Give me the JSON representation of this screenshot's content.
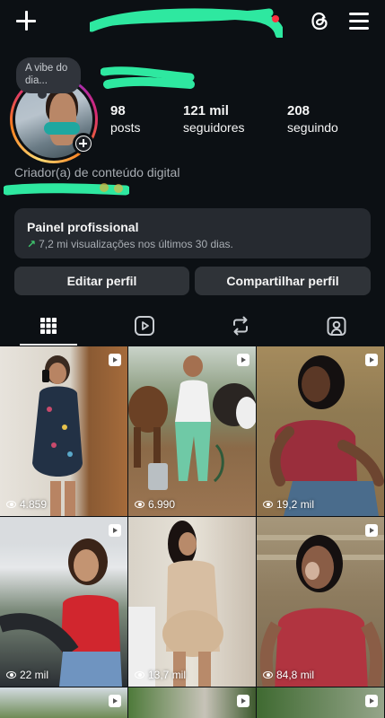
{
  "profile": {
    "note": "A vibe do dia...",
    "stats": [
      {
        "value": "98",
        "label": "posts"
      },
      {
        "value": "121 mil",
        "label": "seguidores"
      },
      {
        "value": "208",
        "label": "seguindo"
      }
    ],
    "category": "Criador(a) de conteúdo digital"
  },
  "panel": {
    "title": "Painel profissional",
    "subtitle": "7,2 mi visualizações nos últimos 30 dias."
  },
  "buttons": {
    "edit": "Editar perfil",
    "share": "Compartilhar perfil"
  },
  "tabs": [
    "grid",
    "reels",
    "reposts",
    "tagged"
  ],
  "grid": [
    {
      "views": "4.859"
    },
    {
      "views": "6.990"
    },
    {
      "views": "19,2 mil"
    },
    {
      "views": "22 mil"
    },
    {
      "views": "13,7 mil"
    },
    {
      "views": "84,8 mil"
    }
  ],
  "colors": {
    "background": "#0c1014",
    "card": "#262a30",
    "button": "#2f3338",
    "notification": "#ff3040",
    "trend": "#3ec46d",
    "redaction": "#2ee8a0"
  }
}
